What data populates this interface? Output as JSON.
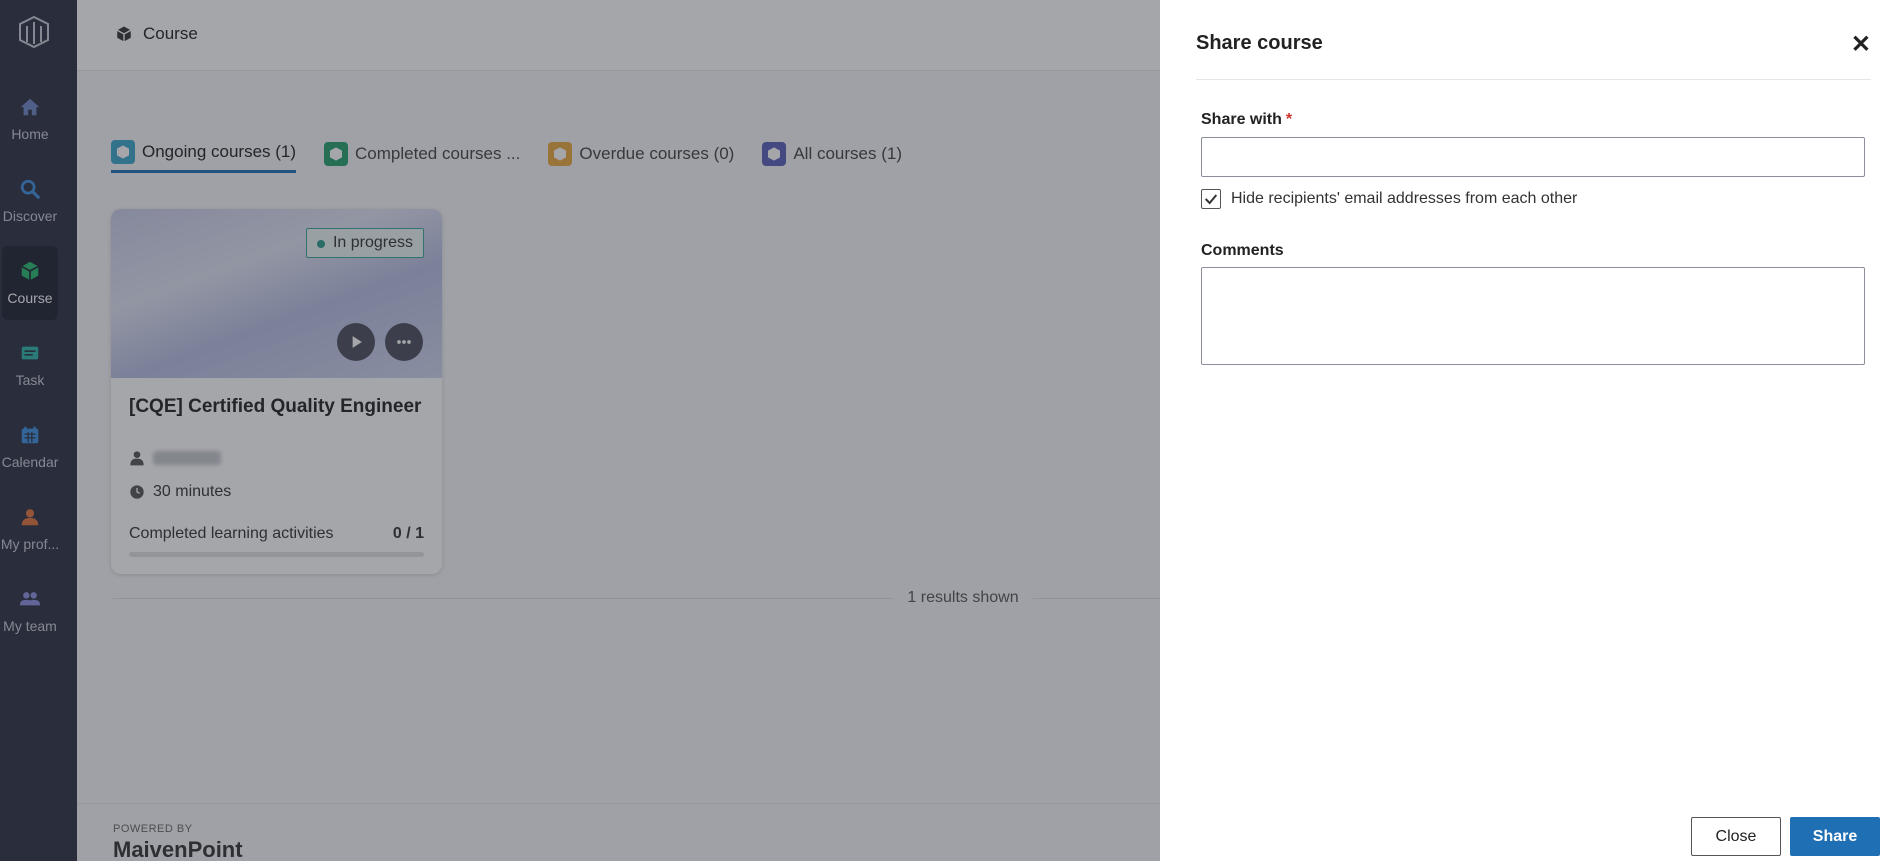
{
  "sidebar": {
    "items": [
      {
        "label": "Home",
        "icon": "home-icon"
      },
      {
        "label": "Discover",
        "icon": "search-icon"
      },
      {
        "label": "Course",
        "icon": "course-icon",
        "active": true
      },
      {
        "label": "Task",
        "icon": "task-icon"
      },
      {
        "label": "Calendar",
        "icon": "calendar-icon"
      },
      {
        "label": "My prof...",
        "icon": "profile-icon"
      },
      {
        "label": "My team",
        "icon": "team-icon"
      }
    ]
  },
  "header": {
    "breadcrumb": "Course"
  },
  "tabs": [
    {
      "label": "Ongoing courses (1)",
      "color": "#3aa6c9",
      "active": true
    },
    {
      "label": "Completed courses ...",
      "color": "#27a06c"
    },
    {
      "label": "Overdue courses (0)",
      "color": "#e8a93c"
    },
    {
      "label": "All courses (1)",
      "color": "#5a5fb8"
    }
  ],
  "course_card": {
    "status": "In progress",
    "title": "[CQE] Certified Quality Engineer",
    "duration": "30 minutes",
    "progress_label": "Completed learning activities",
    "progress_value": "0 / 1",
    "progress_fraction": 0
  },
  "results_text": "1 results shown",
  "footer": {
    "powered_by": "POWERED BY",
    "brand": "MaivenPoint"
  },
  "share_panel": {
    "title": "Share course",
    "share_with_label": "Share with",
    "required_marker": "*",
    "share_with_value": "",
    "hide_recipients_label": "Hide recipients' email addresses from each other",
    "hide_recipients_checked": true,
    "comments_label": "Comments",
    "comments_value": "",
    "close_label": "Close",
    "share_label": "Share"
  },
  "colors": {
    "sidebar": "#2b3142",
    "accent": "#1f6fb5",
    "status": "#2b9b8e"
  }
}
